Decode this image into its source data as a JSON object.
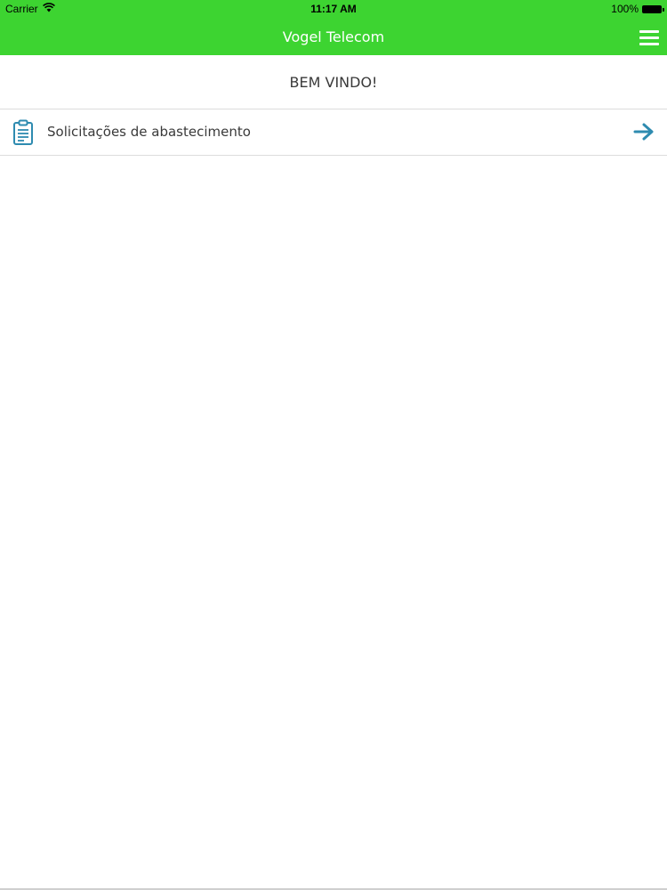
{
  "status_bar": {
    "carrier": "Carrier",
    "time": "11:17 AM",
    "battery": "100%"
  },
  "nav": {
    "title": "Vogel Telecom",
    "menu_icon": "hamburger-menu-icon"
  },
  "welcome": {
    "text": "BEM VINDO!"
  },
  "menu": {
    "items": [
      {
        "label": "Solicitações de abastecimento",
        "icon": "clipboard-icon",
        "action_icon": "arrow-right-icon"
      }
    ]
  },
  "colors": {
    "brand": "#3dd431",
    "accent": "#2e8bb0",
    "text": "#3a3a3a"
  }
}
